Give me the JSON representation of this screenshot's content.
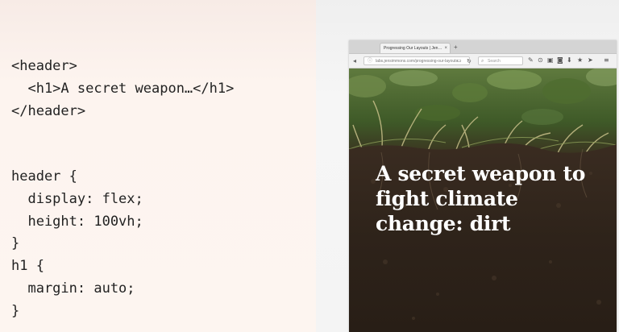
{
  "code": {
    "lines": [
      "<header>",
      "  <h1>A secret weapon…</h1>",
      "</header>",
      "",
      "",
      "header {",
      "  display: flex;",
      "  height: 100vh;",
      "}",
      "h1 {",
      "  margin: auto;",
      "}"
    ]
  },
  "browser": {
    "tab_title": "Progressing Our Layouts | Jen…",
    "url": "labs.jensimmons.com/progressing-our-layouts",
    "search_placeholder": "Search"
  },
  "page": {
    "headline": "A secret weapon to fight climate change: dirt"
  }
}
